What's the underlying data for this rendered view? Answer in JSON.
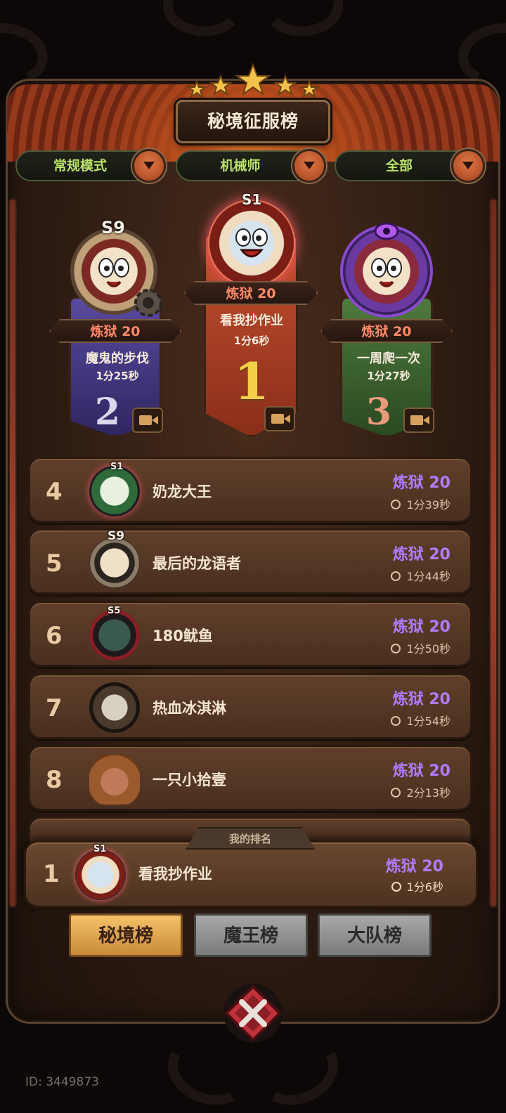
{
  "header": {
    "title": "秘境征服榜"
  },
  "filters": [
    {
      "label": "常规模式"
    },
    {
      "label": "机械师"
    },
    {
      "label": "全部"
    }
  ],
  "podium": {
    "first": {
      "season": "S1",
      "level": "炼狱 20",
      "name": "看我抄作业",
      "time": "1分6秒",
      "rank": "1"
    },
    "second": {
      "season": "S9",
      "level": "炼狱 20",
      "name": "魔鬼的步伐",
      "time": "1分25秒",
      "rank": "2"
    },
    "third": {
      "level": "炼狱 20",
      "name": "一周爬一次",
      "time": "1分27秒",
      "rank": "3"
    }
  },
  "rows": [
    {
      "rank": "4",
      "season": "S1",
      "name": "奶龙大王",
      "level": "炼狱 20",
      "time": "1分39秒"
    },
    {
      "rank": "5",
      "season": "S9",
      "name": "最后的龙语者",
      "level": "炼狱 20",
      "time": "1分44秒"
    },
    {
      "rank": "6",
      "season": "S5",
      "name": "180鱿鱼",
      "level": "炼狱 20",
      "time": "1分50秒"
    },
    {
      "rank": "7",
      "name": "热血冰淇淋",
      "level": "炼狱 20",
      "time": "1分54秒"
    },
    {
      "rank": "8",
      "name": "一只小拾壹",
      "level": "炼狱 20",
      "time": "2分13秒"
    }
  ],
  "my_rank": {
    "tag": "我的排名",
    "rank": "1",
    "season": "S1",
    "name": "看我抄作业",
    "level": "炼狱 20",
    "time": "1分6秒"
  },
  "tabs": [
    {
      "label": "秘境榜",
      "active": true
    },
    {
      "label": "魔王榜",
      "active": false
    },
    {
      "label": "大队榜",
      "active": false
    }
  ],
  "footer": {
    "id": "ID: 3449873"
  },
  "colors": {
    "level_purple": "#b07cff",
    "filter_green": "#b9e36a",
    "rank_red": "#ff8a6a",
    "first_banner": "#b5432a",
    "second_banner": "#4a3a8a",
    "third_banner": "#3f6a35"
  }
}
